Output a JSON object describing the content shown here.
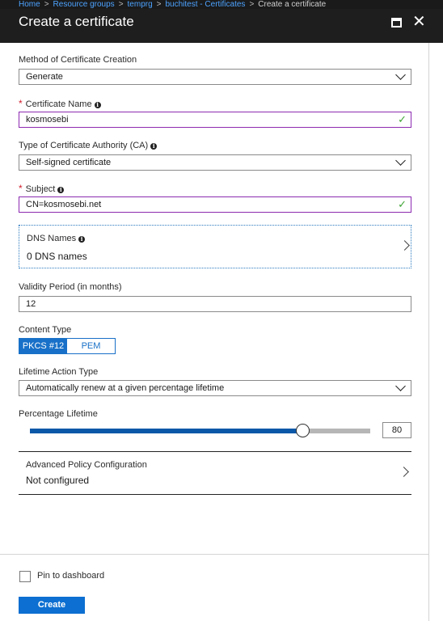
{
  "breadcrumb": {
    "items": [
      "Home",
      "Resource groups",
      "temprg",
      "buchitest - Certificates"
    ],
    "current": "Create a certificate",
    "separator": ">"
  },
  "blade": {
    "title": "Create a certificate"
  },
  "form": {
    "method": {
      "label": "Method of Certificate Creation",
      "value": "Generate"
    },
    "cert_name": {
      "label": "Certificate Name",
      "value": "kosmosebi",
      "required": true
    },
    "ca_type": {
      "label": "Type of Certificate Authority (CA)",
      "value": "Self-signed certificate"
    },
    "subject": {
      "label": "Subject",
      "value": "CN=kosmosebi.net",
      "required": true
    },
    "dns": {
      "label": "DNS Names",
      "value": "0 DNS names"
    },
    "validity": {
      "label": "Validity Period (in months)",
      "value": "12"
    },
    "content_type": {
      "label": "Content Type",
      "options": [
        "PKCS #12",
        "PEM"
      ],
      "selected": "PKCS #12"
    },
    "lifetime_action": {
      "label": "Lifetime Action Type",
      "value": "Automatically renew at a given percentage lifetime"
    },
    "percentage_lifetime": {
      "label": "Percentage Lifetime",
      "value": "80",
      "min": 0,
      "max": 100,
      "level": 0.8
    },
    "advanced": {
      "label": "Advanced Policy Configuration",
      "value": "Not configured"
    }
  },
  "footer": {
    "pin_label": "Pin to dashboard",
    "pin_checked": false,
    "create_label": "Create"
  },
  "colors": {
    "accent": "#0c6fd1",
    "valid_border": "#8c2ab0",
    "check": "#3fa535",
    "required": "#d21f2c"
  }
}
